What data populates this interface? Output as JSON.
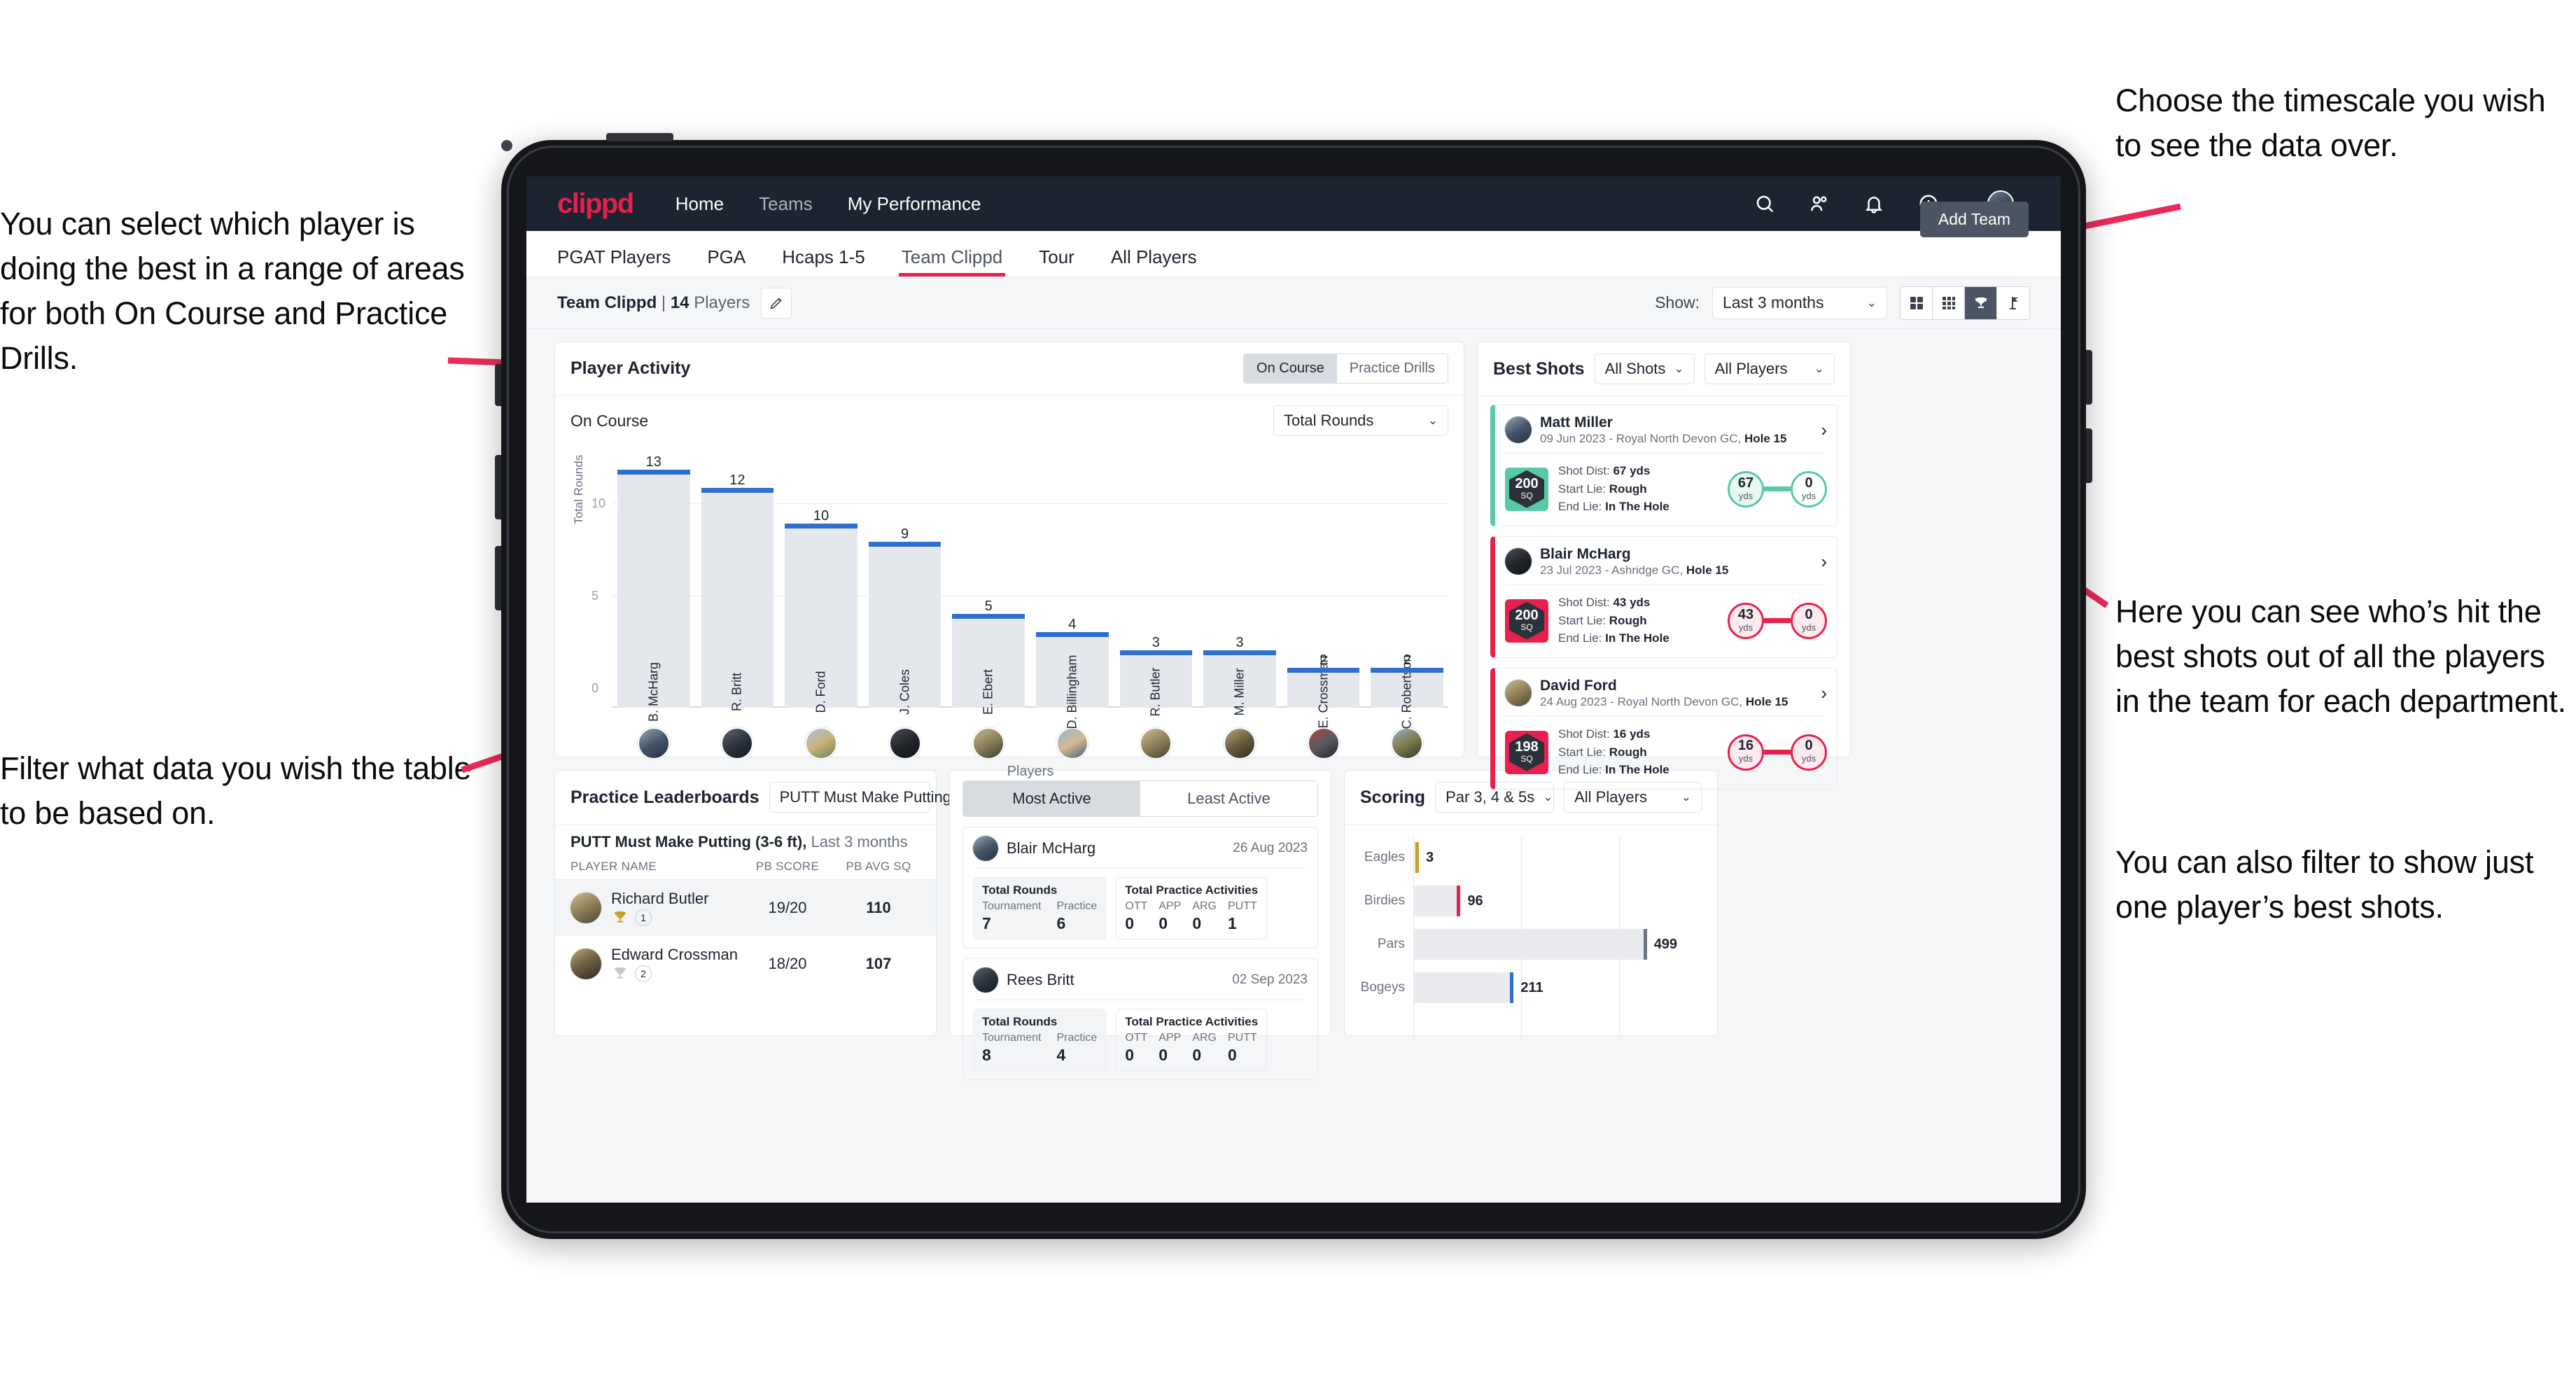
{
  "annotations": {
    "select_player": "You can select which player is doing the best in a range of areas for both On Course and Practice Drills.",
    "filter_table": "Filter what data you wish the table to be based on.",
    "timescale": "Choose the timescale you wish to see the data over.",
    "best_shots": "Here you can see who’s hit the best shots out of all the players in the team for each department.",
    "filter_player": "You can also filter to show just one player’s best shots."
  },
  "navbar": {
    "logo": "clippd",
    "links": [
      {
        "label": "Home"
      },
      {
        "label": "Teams"
      },
      {
        "label": "My Performance"
      }
    ],
    "icons": [
      "search-icon",
      "people-icon",
      "bell-icon",
      "plus-circle-icon",
      "avatar-icon"
    ]
  },
  "tabs": {
    "items": [
      {
        "label": "PGAT Players",
        "active": false
      },
      {
        "label": "PGA",
        "active": false
      },
      {
        "label": "Hcaps 1-5",
        "active": false
      },
      {
        "label": "Team Clippd",
        "active": true
      },
      {
        "label": "Tour",
        "active": false
      },
      {
        "label": "All Players",
        "active": false
      }
    ],
    "add_team_label": "Add Team"
  },
  "subheader": {
    "team_name": "Team Clippd",
    "separator": "|",
    "player_count": "14",
    "players_word": "Players",
    "show_label": "Show:",
    "show_value": "Last 3 months",
    "view_buttons": [
      "grid-large-icon",
      "grid-small-icon",
      "trophy-icon",
      "flag-icon"
    ],
    "active_view": "trophy-icon"
  },
  "player_activity": {
    "title": "Player Activity",
    "segments": [
      {
        "label": "On Course",
        "active": true
      },
      {
        "label": "Practice Drills",
        "active": false
      }
    ],
    "sub_label": "On Course",
    "metric_select": "Total Rounds"
  },
  "best_shots": {
    "title": "Best Shots",
    "shot_filter": "All Shots",
    "player_filter": "All Players",
    "cards": [
      {
        "name": "Matt Miller",
        "meta_date": "09 Jun 2023 - Royal North Devon GC,",
        "meta_hole": "Hole 15",
        "sq": "200",
        "sq_unit": "SQ",
        "shot_dist_label": "Shot Dist:",
        "shot_dist": "67 yds",
        "start_lie_label": "Start Lie:",
        "start_lie": "Rough",
        "end_lie_label": "End Lie:",
        "end_lie": "In The Hole",
        "start_val": "67",
        "start_unit": "yds",
        "end_val": "0",
        "end_unit": "yds",
        "accent": "#58c9a8"
      },
      {
        "name": "Blair McHarg",
        "meta_date": "23 Jul 2023 - Ashridge GC,",
        "meta_hole": "Hole 15",
        "sq": "200",
        "sq_unit": "SQ",
        "shot_dist_label": "Shot Dist:",
        "shot_dist": "43 yds",
        "start_lie_label": "Start Lie:",
        "start_lie": "Rough",
        "end_lie_label": "End Lie:",
        "end_lie": "In The Hole",
        "start_val": "43",
        "start_unit": "yds",
        "end_val": "0",
        "end_unit": "yds",
        "accent": "#e8204e"
      },
      {
        "name": "David Ford",
        "meta_date": "24 Aug 2023 - Royal North Devon GC,",
        "meta_hole": "Hole 15",
        "sq": "198",
        "sq_unit": "SQ",
        "shot_dist_label": "Shot Dist:",
        "shot_dist": "16 yds",
        "start_lie_label": "Start Lie:",
        "start_lie": "Rough",
        "end_lie_label": "End Lie:",
        "end_lie": "In The Hole",
        "start_val": "16",
        "start_unit": "yds",
        "end_val": "0",
        "end_unit": "yds",
        "accent": "#e8204e"
      }
    ]
  },
  "practice_leaderboards": {
    "title": "Practice Leaderboards",
    "drill_select": "PUTT Must Make Putting ...",
    "subtitle_bold": "PUTT Must Make Putting (3-6 ft),",
    "subtitle_gray": "Last 3 months",
    "columns": [
      "PLAYER NAME",
      "PB SCORE",
      "PB AVG SQ"
    ],
    "rows": [
      {
        "name": "Richard Butler",
        "rank": "1",
        "pb_score": "19/20",
        "pb_avg_sq": "110",
        "trophy": "gold"
      },
      {
        "name": "Edward Crossman",
        "rank": "2",
        "pb_score": "18/20",
        "pb_avg_sq": "107",
        "trophy": "silver"
      }
    ]
  },
  "activity_panel": {
    "tabs": [
      {
        "label": "Most Active",
        "active": true
      },
      {
        "label": "Least Active",
        "active": false
      }
    ],
    "cards": [
      {
        "name": "Blair McHarg",
        "date": "26 Aug 2023",
        "rounds_title": "Total Rounds",
        "rounds": [
          {
            "label": "Tournament",
            "value": "7"
          },
          {
            "label": "Practice",
            "value": "6"
          }
        ],
        "practice_title": "Total Practice Activities",
        "practice": [
          {
            "label": "OTT",
            "value": "0"
          },
          {
            "label": "APP",
            "value": "0"
          },
          {
            "label": "ARG",
            "value": "0"
          },
          {
            "label": "PUTT",
            "value": "1"
          }
        ]
      },
      {
        "name": "Rees Britt",
        "date": "02 Sep 2023",
        "rounds_title": "Total Rounds",
        "rounds": [
          {
            "label": "Tournament",
            "value": "8"
          },
          {
            "label": "Practice",
            "value": "4"
          }
        ],
        "practice_title": "Total Practice Activities",
        "practice": [
          {
            "label": "OTT",
            "value": "0"
          },
          {
            "label": "APP",
            "value": "0"
          },
          {
            "label": "ARG",
            "value": "0"
          },
          {
            "label": "PUTT",
            "value": "0"
          }
        ]
      }
    ]
  },
  "scoring": {
    "title": "Scoring",
    "par_filter": "Par 3, 4 & 5s",
    "player_filter": "All Players"
  },
  "chart_data": [
    {
      "type": "bar",
      "title": "Player Activity - On Course",
      "xlabel": "Players",
      "ylabel": "Total Rounds",
      "categories": [
        "B. McHarg",
        "R. Britt",
        "D. Ford",
        "J. Coles",
        "E. Ebert",
        "D. Billingham",
        "R. Butler",
        "M. Miller",
        "E. Crossman",
        "C. Robertson"
      ],
      "values": [
        13,
        12,
        10,
        9,
        5,
        4,
        3,
        3,
        2,
        2
      ],
      "ylim": [
        0,
        13
      ],
      "yticks": [
        0,
        5,
        10
      ],
      "grid": true,
      "bar_color": "#e4e7ec",
      "cap_color": "#2f6fd0",
      "legend": "none"
    },
    {
      "type": "bar",
      "orientation": "horizontal",
      "title": "Scoring",
      "categories": [
        "Eagles",
        "Birdies",
        "Pars",
        "Bogeys"
      ],
      "values": [
        3,
        96,
        499,
        211
      ],
      "colors": [
        "#c9a227",
        "#e8204e",
        "#6b7280",
        "#2f6fd0"
      ],
      "xlim": [
        0,
        560
      ],
      "grid": true,
      "track_color": "#e9ebef"
    }
  ]
}
